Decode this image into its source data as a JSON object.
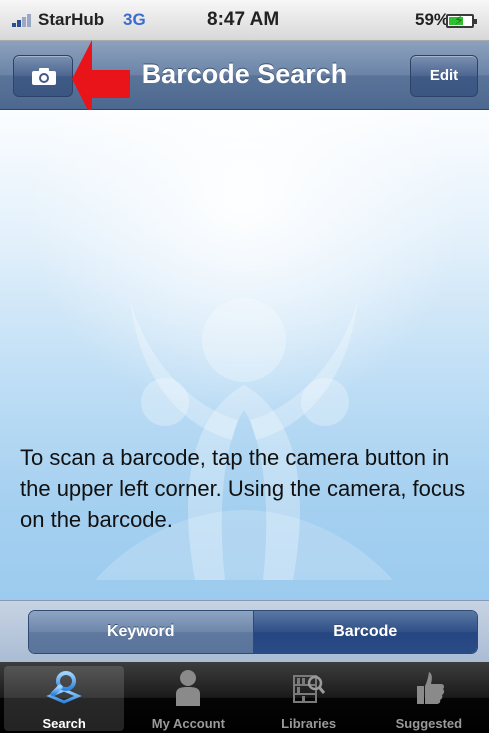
{
  "status_bar": {
    "carrier": "StarHub",
    "network": "3G",
    "time": "8:47 AM",
    "battery_percent": "59%",
    "battery_level": 0.59
  },
  "nav_bar": {
    "title": "Barcode Search",
    "left_button_icon": "camera-icon",
    "right_button_label": "Edit"
  },
  "content": {
    "instructions": "To scan a barcode, tap the camera button in the upper left corner. Using the camera, focus on the barcode."
  },
  "segmented_control": {
    "options": [
      "Keyword",
      "Barcode"
    ],
    "selected": "Barcode"
  },
  "tab_bar": {
    "tabs": [
      {
        "label": "Search",
        "icon": "magnifier-book-icon",
        "active": true
      },
      {
        "label": "My Account",
        "icon": "person-icon",
        "active": false
      },
      {
        "label": "Libraries",
        "icon": "shelf-search-icon",
        "active": false
      },
      {
        "label": "Suggested",
        "icon": "thumbs-up-icon",
        "active": false
      }
    ]
  },
  "colors": {
    "nav_bar": "#5a7499",
    "annotation_arrow": "#e8141a",
    "selected_segment": "#2a4b86",
    "content_background": "#a5d0f0"
  }
}
